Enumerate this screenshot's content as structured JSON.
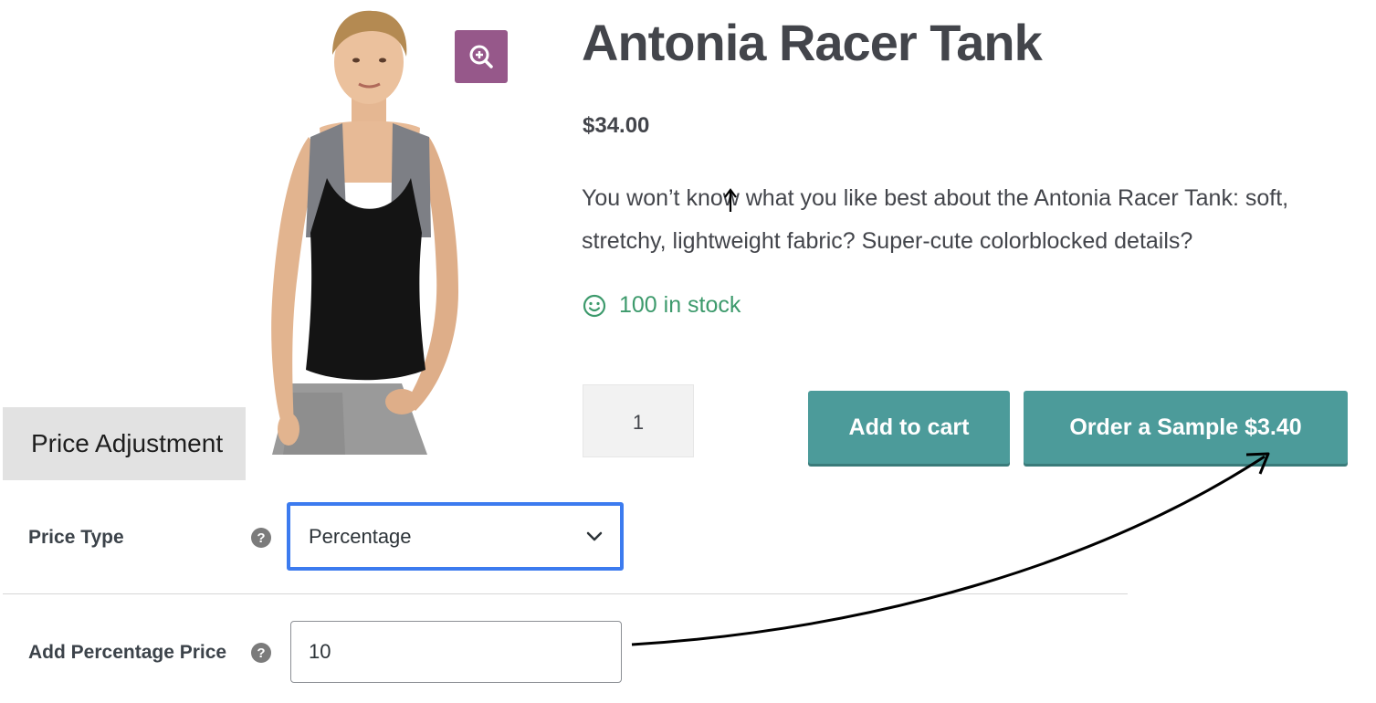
{
  "product": {
    "title": "Antonia Racer Tank",
    "price": "$34.00",
    "description": "You won’t know what you like best about the Antonia Racer Tank: soft, stretchy, lightweight fabric? Super-cute colorblocked details?",
    "stock": "100 in stock",
    "quantity": "1",
    "add_to_cart_label": "Add to cart",
    "order_sample_label": "Order a Sample $3.40"
  },
  "admin": {
    "tab_label": "Price Adjustment",
    "price_type_label": "Price Type",
    "price_type_value": "Percentage",
    "percentage_label": "Add Percentage Price",
    "percentage_value": "10"
  },
  "colors": {
    "accent_purple": "#96588a",
    "button_teal": "#4c9b9a",
    "stock_green": "#3d9a6c",
    "focus_blue": "#3c7bef"
  },
  "icons": [
    "zoom-in-icon",
    "smiley-icon",
    "help-icon",
    "chevron-down-icon"
  ]
}
